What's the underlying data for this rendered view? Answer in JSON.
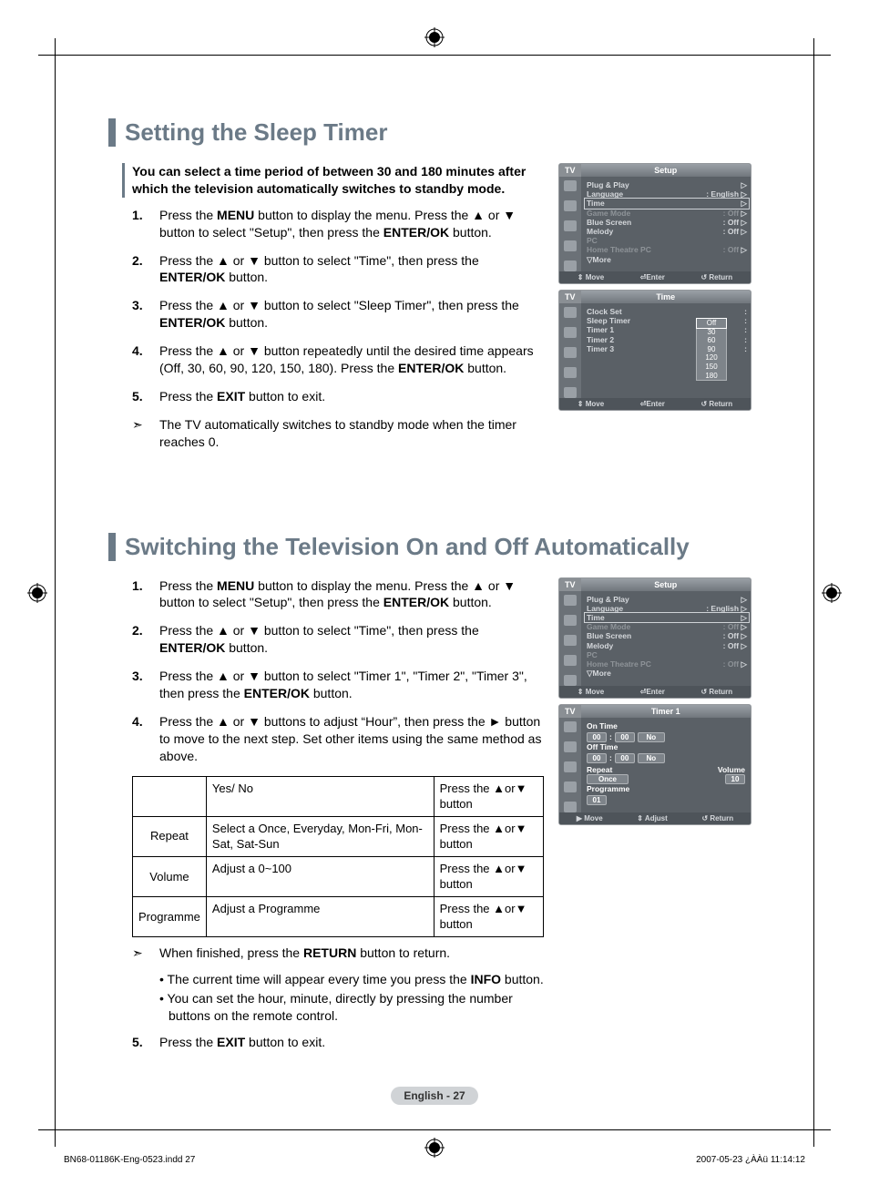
{
  "section1": {
    "title": "Setting the Sleep Timer",
    "intro": "You can select a time period of between 30 and 180 minutes after which the television automatically switches to standby mode.",
    "steps": [
      "Press the <b>MENU</b> button to display the menu. Press the ▲ or ▼ button to select \"Setup\", then press the <b>ENTER/OK</b> button.",
      "Press the ▲ or ▼ button to select \"Time\", then press the <b>ENTER/OK</b> button.",
      "Press the ▲ or ▼ button to select \"Sleep Timer\", then press the <b>ENTER/OK</b> button.",
      "Press the ▲ or ▼ button repeatedly until the desired time appears (Off, 30, 60, 90, 120, 150, 180). Press the <b>ENTER/OK</b> button.",
      "Press the <b>EXIT</b> button to exit."
    ],
    "note": "The TV automatically switches to standby mode when the timer reaches 0."
  },
  "section2": {
    "title": "Switching the Television On and Off Automatically",
    "steps": [
      "Press the <b>MENU</b> button to display the menu. Press the ▲ or ▼ button to select \"Setup\", then press the <b>ENTER/OK</b> button.",
      "Press the ▲ or ▼ button to select \"Time\", then press the <b>ENTER/OK</b> button.",
      "Press the ▲ or ▼ button to select \"Timer 1\", \"Timer 2\", \"Timer 3\", then press the <b>ENTER/OK</b> button.",
      "Press the ▲ or ▼ buttons to adjust “Hour”, then press the ► button to move to the next step. Set other items using the same method as above."
    ],
    "table": [
      [
        "",
        "Yes/ No",
        "Press the ▲or▼ button"
      ],
      [
        "Repeat",
        "Select a Once, Everyday, Mon-Fri, Mon-Sat, Sat-Sun",
        "Press the ▲or▼ button"
      ],
      [
        "Volume",
        "Adjust a 0~100",
        "Press the ▲or▼ button"
      ],
      [
        "Programme",
        "Adjust a Programme",
        "Press the ▲or▼ button"
      ]
    ],
    "note1": "When finished, press the <b>RETURN</b> button to return.",
    "bullets": [
      "• The current time will appear every time you press the <b>INFO</b> button.",
      "• You can set the hour, minute, directly by pressing the number buttons on the remote control."
    ],
    "step5": "Press the <b>EXIT</b> button to exit."
  },
  "osd_setup": {
    "tv": "TV",
    "title": "Setup",
    "items": [
      {
        "label": "Plug & Play",
        "value": "",
        "dim": false,
        "tri": true
      },
      {
        "label": "Language",
        "value": ": English",
        "dim": false,
        "tri": true
      },
      {
        "label": "Time",
        "value": "",
        "dim": false,
        "tri": true,
        "hl": true
      },
      {
        "label": "Game Mode",
        "value": ": Off",
        "dim": true,
        "tri": true
      },
      {
        "label": "Blue Screen",
        "value": ": Off",
        "dim": false,
        "tri": true
      },
      {
        "label": "Melody",
        "value": ": Off",
        "dim": false,
        "tri": true
      },
      {
        "label": "PC",
        "value": "",
        "dim": true,
        "tri": false
      },
      {
        "label": "Home Theatre PC",
        "value": ": Off",
        "dim": true,
        "tri": true
      },
      {
        "label": "▽More",
        "value": "",
        "dim": false,
        "tri": false
      }
    ],
    "footer": [
      "⇕ Move",
      "⏎Enter",
      "↺ Return"
    ]
  },
  "osd_time": {
    "tv": "TV",
    "title": "Time",
    "items": [
      {
        "label": "Clock Set",
        "value": ":"
      },
      {
        "label": "Sleep Timer",
        "value": ":"
      },
      {
        "label": "Timer 1",
        "value": ":"
      },
      {
        "label": "Timer 2",
        "value": ":"
      },
      {
        "label": "Timer 3",
        "value": ":"
      }
    ],
    "popup": [
      "Off",
      "30",
      "60",
      "90",
      "120",
      "150",
      "180"
    ],
    "popup_current": "Off",
    "footer": [
      "⇕ Move",
      "⏎Enter",
      "↺ Return"
    ]
  },
  "osd_timer1": {
    "tv": "TV",
    "title": "Timer 1",
    "on_time_label": "On Time",
    "on_h": "00",
    "on_m": "00",
    "on_state": "No",
    "off_time_label": "Off Time",
    "off_h": "00",
    "off_m": "00",
    "off_state": "No",
    "repeat_label": "Repeat",
    "repeat_value": "Once",
    "volume_label": "Volume",
    "volume_value": "10",
    "programme_label": "Programme",
    "programme_value": "01",
    "footer": [
      "▶ Move",
      "⇕ Adjust",
      "↺ Return"
    ]
  },
  "page_number": "English - 27",
  "footer": {
    "file": "BN68-01186K-Eng-0523.indd   27",
    "date": "2007-05-23   ¿ÀÀü 11:14:12"
  }
}
